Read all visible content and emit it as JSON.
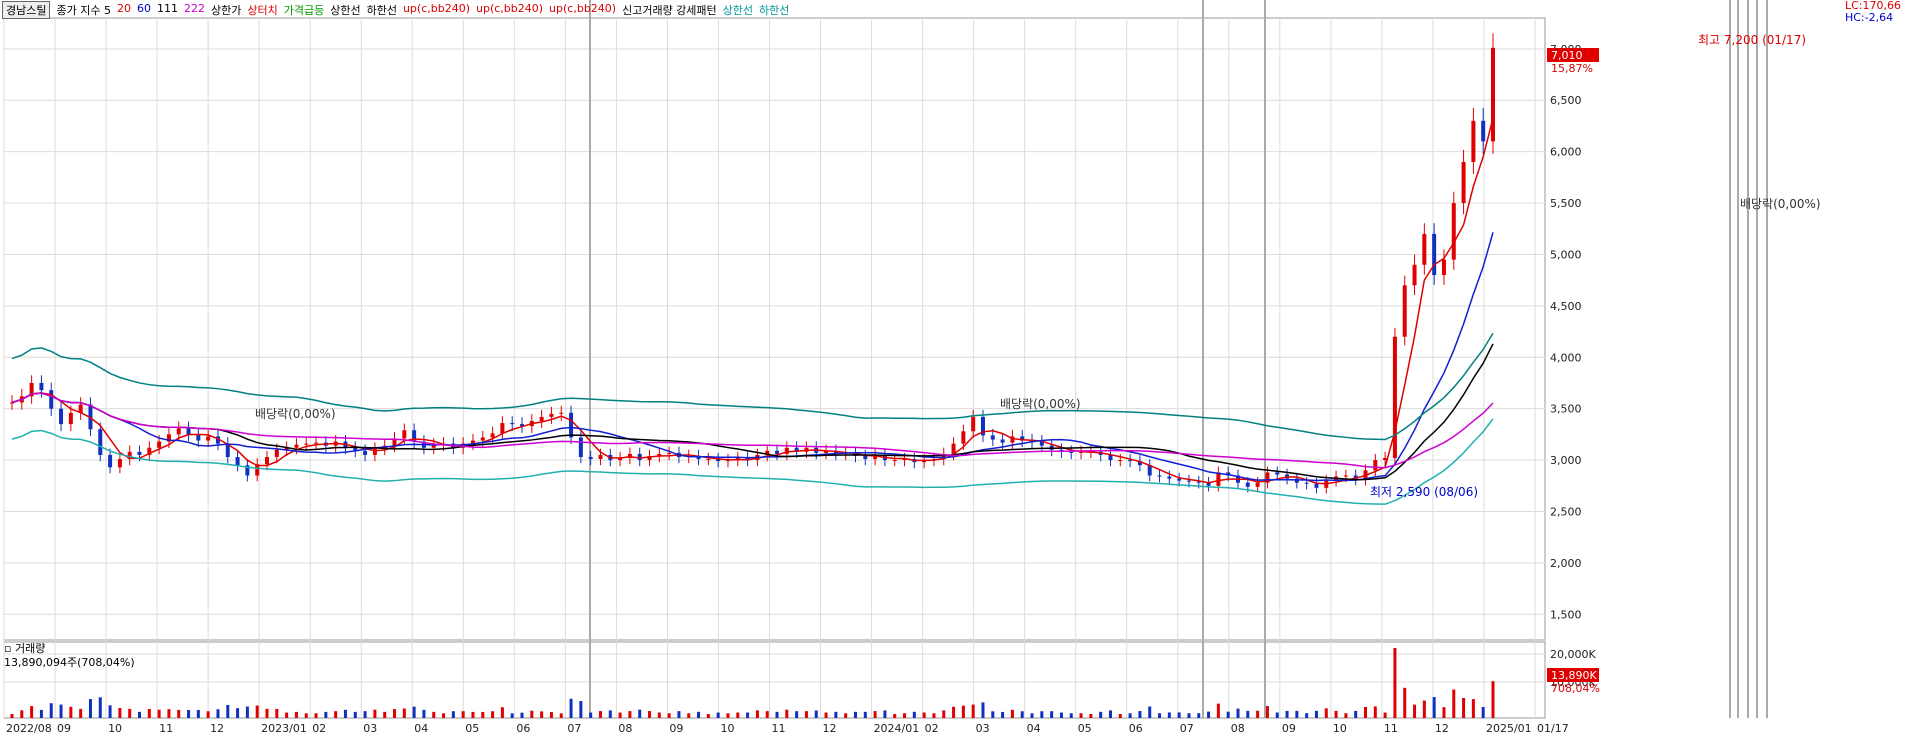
{
  "title": "경남스틸",
  "legend": {
    "items": [
      {
        "text": "종가 지수 5",
        "color": "#000"
      },
      {
        "text": "20",
        "color": "#d00"
      },
      {
        "text": "60",
        "color": "#00c"
      },
      {
        "text": "111",
        "color": "#000"
      },
      {
        "text": "222",
        "color": "#c0c"
      },
      {
        "text": "상한가",
        "color": "#000"
      },
      {
        "text": "상터치",
        "color": "#d00"
      },
      {
        "text": "가격급등",
        "color": "#090"
      },
      {
        "text": "상한선",
        "color": "#000"
      },
      {
        "text": "하한선",
        "color": "#000"
      },
      {
        "text": "up(c,bb240)",
        "color": "#d00"
      },
      {
        "text": "up(c,bb240)",
        "color": "#d00"
      },
      {
        "text": "up(c,bb240)",
        "color": "#d00"
      },
      {
        "text": "신고거래량 강세패턴",
        "color": "#000"
      },
      {
        "text": "상한선",
        "color": "#099"
      },
      {
        "text": "하한선",
        "color": "#099"
      }
    ]
  },
  "corner": {
    "lc": "LC:170,66",
    "hc": "HC:-2,64"
  },
  "volume_panel": {
    "title": "거래량",
    "value_line": "13,890,094주(708,04%)"
  },
  "annotations": {
    "high": "최고 7,200 (01/17)",
    "low": "최저 2,590 (08/06)",
    "div1": "배당락(0,00%)",
    "div2": "배당락(0,00%)",
    "div3": "배당락(0,00%)"
  },
  "price_tag": {
    "value": "7,010",
    "pct": "15,87%"
  },
  "volume_tag": {
    "value": "13,890K",
    "pct": "708,04%"
  },
  "colors": {
    "up": "#e00000",
    "down": "#1030c0",
    "grid": "#dcdcdc",
    "ma20": "#e00000",
    "ma60": "#1020d0",
    "ma111": "#000000",
    "ma222": "#d000d0",
    "bbUpper": "#008080",
    "bbLower": "#20b0b0"
  },
  "chart_data": {
    "type": "line",
    "title": "경남스틸",
    "x_tick_labels": [
      "2022/08",
      "09",
      "10",
      "11",
      "12",
      "2023/01",
      "02",
      "03",
      "04",
      "05",
      "06",
      "07",
      "08",
      "09",
      "10",
      "11",
      "12",
      "2024/01",
      "02",
      "03",
      "04",
      "05",
      "06",
      "07",
      "08",
      "09",
      "10",
      "11",
      "12",
      "2025/01",
      "01/17"
    ],
    "y_tick_labels": [
      "1,500",
      "2,000",
      "2,500",
      "3,000",
      "3,500",
      "4,000",
      "4,500",
      "5,000",
      "5,500",
      "6,000",
      "6,500",
      "7,000"
    ],
    "volume_tick_labels": [
      "20,000K",
      "10,000K"
    ],
    "ylim": [
      1250,
      7300
    ],
    "series": [
      {
        "name": "종가",
        "values": [
          3560,
          3620,
          3750,
          3680,
          3500,
          3350,
          3460,
          3540,
          3300,
          3050,
          2930,
          3010,
          3080,
          3050,
          3120,
          3180,
          3250,
          3310,
          3250,
          3190,
          3230,
          3160,
          3030,
          2950,
          2850,
          2960,
          3030,
          3100,
          3120,
          3150,
          3160,
          3170,
          3140,
          3180,
          3120,
          3090,
          3050,
          3110,
          3140,
          3210,
          3290,
          3180,
          3120,
          3150,
          3160,
          3120,
          3160,
          3190,
          3220,
          3260,
          3360,
          3350,
          3330,
          3380,
          3420,
          3450,
          3460,
          3220,
          3030,
          3010,
          3050,
          3000,
          3020,
          3060,
          3000,
          3040,
          3060,
          3070,
          3030,
          3040,
          3010,
          3010,
          2990,
          3000,
          3020,
          3000,
          3050,
          3090,
          3060,
          3120,
          3080,
          3120,
          3070,
          3090,
          3060,
          3070,
          3040,
          3010,
          3050,
          3000,
          3000,
          3010,
          2980,
          3000,
          3010,
          3060,
          3160,
          3280,
          3420,
          3240,
          3200,
          3170,
          3230,
          3190,
          3180,
          3140,
          3100,
          3080,
          3070,
          3080,
          3080,
          3050,
          3000,
          3000,
          2990,
          2950,
          2850,
          2840,
          2820,
          2800,
          2790,
          2780,
          2750,
          2880,
          2850,
          2780,
          2740,
          2780,
          2880,
          2860,
          2820,
          2780,
          2770,
          2730,
          2800,
          2840,
          2850,
          2810,
          2900,
          3000,
          3020,
          4200,
          4700,
          4900,
          5200,
          4800,
          4950,
          5500,
          5900,
          6300,
          6100,
          7010
        ]
      }
    ],
    "max_point": {
      "label": "최고 7,200 (01/17)",
      "value": 7200
    },
    "min_point": {
      "label": "최저 2,590 (08/06)",
      "value": 2590
    }
  }
}
